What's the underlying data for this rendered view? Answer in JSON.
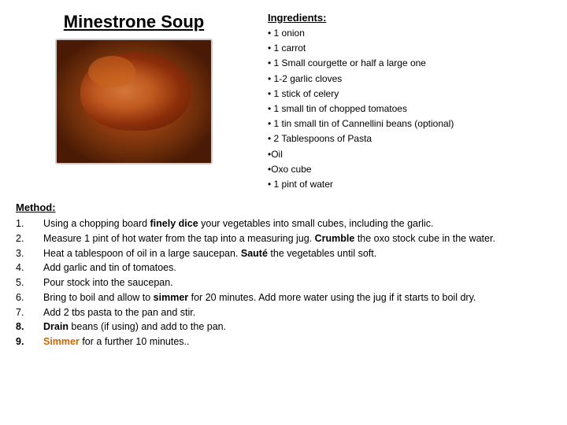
{
  "title": "Minestrone Soup",
  "ingredients": {
    "heading": "Ingredients:",
    "items": [
      "• 1 onion",
      "• 1 carrot",
      "• 1 Small courgette or half  a large one",
      "• 1-2 garlic cloves",
      "• 1 stick of  celery",
      "• 1 small tin of chopped tomatoes",
      "• 1 tin small tin of Cannellini beans (optional)",
      "• 2 Tablespoons of Pasta",
      "•Oil",
      "•Oxo cube",
      "• 1 pint of water"
    ]
  },
  "method": {
    "heading": "Method:",
    "steps": [
      {
        "num": "1.",
        "bold_num": false,
        "text_parts": [
          {
            "text": "Using a chopping board ",
            "style": "normal"
          },
          {
            "text": "finely dice",
            "style": "bold"
          },
          {
            "text": " your vegetables into small cubes, including the garlic.",
            "style": "normal"
          }
        ]
      },
      {
        "num": "2.",
        "bold_num": false,
        "text_parts": [
          {
            "text": "Measure 1 pint of hot water from the tap into a measuring jug. ",
            "style": "normal"
          },
          {
            "text": "Crumble",
            "style": "bold"
          },
          {
            "text": "  the oxo stock cube in the water.",
            "style": "normal"
          }
        ]
      },
      {
        "num": "3.",
        "bold_num": false,
        "text_parts": [
          {
            "text": " Heat a tablespoon of oil in a large saucepan. ",
            "style": "normal"
          },
          {
            "text": "Sauté",
            "style": "bold"
          },
          {
            "text": " the vegetables until soft.",
            "style": "normal"
          }
        ]
      },
      {
        "num": "4.",
        "bold_num": false,
        "text_parts": [
          {
            "text": " Add garlic and tin of tomatoes.",
            "style": "normal"
          }
        ]
      },
      {
        "num": "5.",
        "bold_num": false,
        "text_parts": [
          {
            "text": " Pour  stock into the saucepan.",
            "style": "normal"
          }
        ]
      },
      {
        "num": "6.",
        "bold_num": false,
        "text_parts": [
          {
            "text": "Bring to boil and allow to ",
            "style": "normal"
          },
          {
            "text": "simmer",
            "style": "bold"
          },
          {
            "text": " for 20 minutes. Add more water using the jug if it starts to boil dry.",
            "style": "normal"
          }
        ]
      },
      {
        "num": "7.",
        "bold_num": false,
        "text_parts": [
          {
            "text": "Add 2 tbs pasta to the pan and stir.",
            "style": "normal"
          }
        ]
      },
      {
        "num": "8.",
        "bold_num": true,
        "text_parts": [
          {
            "text": "Drain",
            "style": "bold"
          },
          {
            "text": " beans (if using) and add to the pan.",
            "style": "normal"
          }
        ]
      },
      {
        "num": "9.",
        "bold_num": true,
        "text_parts": [
          {
            "text": "Simmer",
            "style": "green"
          },
          {
            "text": " for a further 10 minutes.",
            "style": "normal"
          },
          {
            "text": ".",
            "style": "normal"
          }
        ]
      }
    ]
  }
}
